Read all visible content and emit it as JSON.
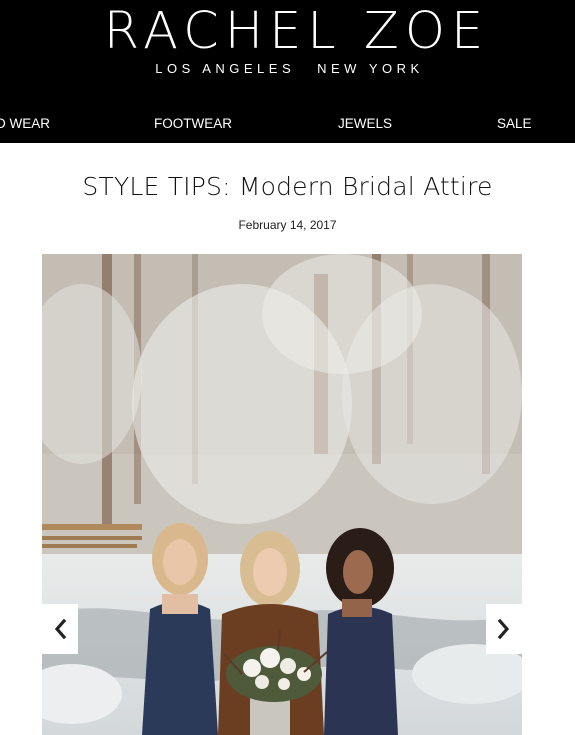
{
  "header": {
    "logo": "RACHEL ZOE",
    "tagline_left": "LOS ANGELES",
    "tagline_right": "NEW YORK"
  },
  "nav": {
    "items": [
      {
        "label": "D WEAR"
      },
      {
        "label": "FOOTWEAR"
      },
      {
        "label": "JEWELS"
      },
      {
        "label": "SALE"
      }
    ]
  },
  "article": {
    "title": "STYLE TIPS: Modern Bridal Attire",
    "date": "February 14, 2017"
  },
  "carousel": {
    "prev_icon": "chevron-left-icon",
    "next_icon": "chevron-right-icon"
  }
}
